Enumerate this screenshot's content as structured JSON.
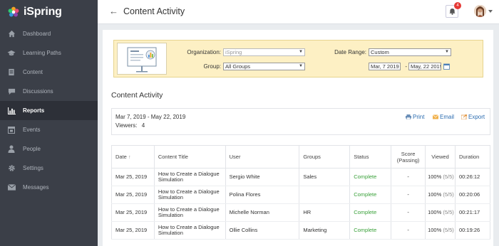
{
  "app": {
    "name": "iSpring"
  },
  "sidebar": {
    "items": [
      {
        "label": "Dashboard",
        "icon": "home-icon"
      },
      {
        "label": "Learning Paths",
        "icon": "graduation-cap-icon"
      },
      {
        "label": "Content",
        "icon": "document-icon"
      },
      {
        "label": "Discussions",
        "icon": "chat-icon"
      },
      {
        "label": "Reports",
        "icon": "bar-chart-icon",
        "active": true
      },
      {
        "label": "Events",
        "icon": "calendar-icon"
      },
      {
        "label": "People",
        "icon": "person-icon"
      },
      {
        "label": "Settings",
        "icon": "gear-icon"
      },
      {
        "label": "Messages",
        "icon": "envelope-icon"
      }
    ]
  },
  "header": {
    "back": "←",
    "title": "Content Activity",
    "notification_count": "4"
  },
  "filters": {
    "organization_label": "Organization:",
    "organization_value": "iSpring",
    "group_label": "Group:",
    "group_value": "All Groups",
    "date_range_label": "Date Range:",
    "date_range_value": "Custom",
    "date_from": "Mar, 7 2019",
    "date_sep": "-",
    "date_to": "May, 22 2019"
  },
  "section_title": "Content Activity",
  "summary": {
    "range": "Mar 7, 2019 - May 22, 2019",
    "viewers_label": "Viewers:",
    "viewers_count": "4",
    "print": "Print",
    "email": "Email",
    "export": "Export"
  },
  "table": {
    "headers": {
      "date": "Date",
      "sort": "↑",
      "title": "Content Title",
      "user": "User",
      "groups": "Groups",
      "status": "Status",
      "score": "Score (Passing)",
      "viewed": "Viewed",
      "duration": "Duration"
    },
    "rows": [
      {
        "date": "Mar 25, 2019",
        "title": "How to Create a Dialogue Simulation",
        "user": "Sergio White",
        "groups": "Sales",
        "status": "Complete",
        "score": "-",
        "viewed": "100%",
        "viewed_detail": "(5/5)",
        "duration": "00:26:12"
      },
      {
        "date": "Mar 25, 2019",
        "title": "How to Create a Dialogue Simulation",
        "user": "Polina Flores",
        "groups": "",
        "status": "Complete",
        "score": "-",
        "viewed": "100%",
        "viewed_detail": "(5/5)",
        "duration": "00:20:06"
      },
      {
        "date": "Mar 25, 2019",
        "title": "How to Create a Dialogue Simulation",
        "user": "Michelle Norman",
        "groups": "HR",
        "status": "Complete",
        "score": "-",
        "viewed": "100%",
        "viewed_detail": "(5/5)",
        "duration": "00:21:17"
      },
      {
        "date": "Mar 25, 2019",
        "title": "How to Create a Dialogue Simulation",
        "user": "Ollie Collins",
        "groups": "Marketing",
        "status": "Complete",
        "score": "-",
        "viewed": "100%",
        "viewed_detail": "(5/5)",
        "duration": "00:19:26"
      }
    ]
  },
  "colors": {
    "sidebar_bg": "#3b3f48",
    "sidebar_active_bg": "#2d3038",
    "filter_bg": "#fdf0c4",
    "link": "#2b6cb0",
    "status_complete": "#3aa13a",
    "badge": "#e53935"
  }
}
